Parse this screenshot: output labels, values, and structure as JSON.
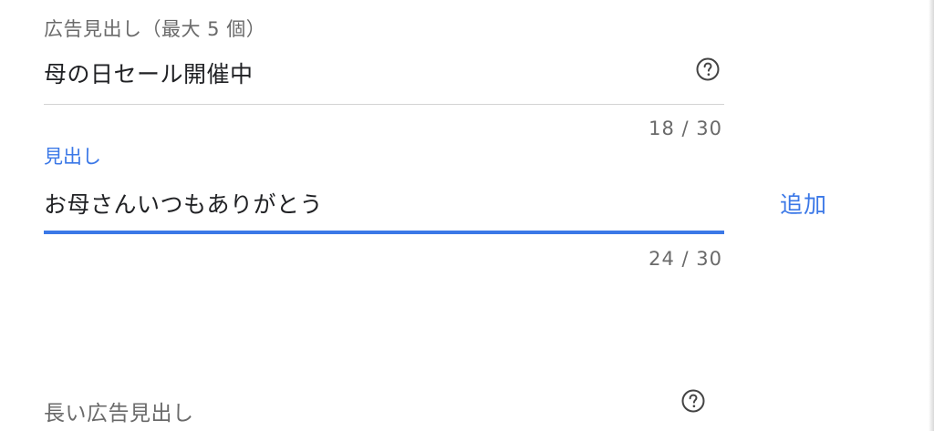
{
  "headlines_section": {
    "label": "広告見出し（最大 5 個）",
    "existing_headline": {
      "value": "母の日セール開催中",
      "counter": "18 / 30",
      "help_icon": "question-circle-icon"
    },
    "new_headline": {
      "floating_label": "見出し",
      "value": "お母さんいつもありがとう",
      "counter": "24 / 30",
      "add_label": "追加"
    }
  },
  "long_headlines_section": {
    "label": "長い広告見出し",
    "help_icon": "question-circle-icon"
  },
  "colors": {
    "accent": "#3b78e7",
    "text": "#202124",
    "secondary_text": "#6a6a6a",
    "divider": "#d3d3d3"
  }
}
